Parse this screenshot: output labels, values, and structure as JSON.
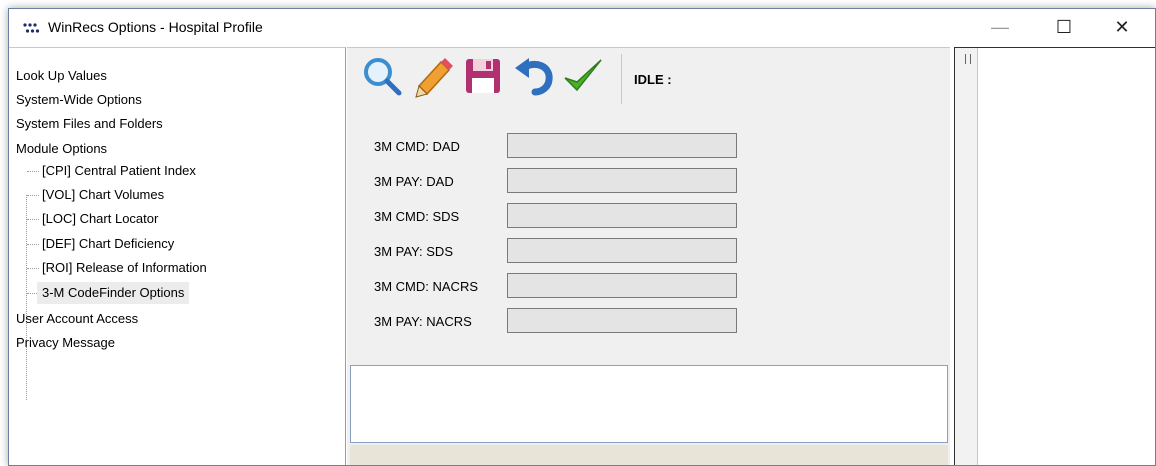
{
  "window": {
    "title": "WinRecs Options - Hospital Profile",
    "controls": {
      "minimize": "—",
      "maximize": "☐",
      "close": "✕"
    }
  },
  "tree": {
    "items": [
      {
        "label": "Look Up Values",
        "level": 0
      },
      {
        "label": "System-Wide Options",
        "level": 0
      },
      {
        "label": "System Files and Folders",
        "level": 0
      },
      {
        "label": "Module Options",
        "level": 0
      },
      {
        "label": "[CPI] Central Patient Index",
        "level": 1
      },
      {
        "label": "[VOL] Chart Volumes",
        "level": 1
      },
      {
        "label": "[LOC] Chart Locator",
        "level": 1
      },
      {
        "label": "[DEF] Chart Deficiency",
        "level": 1
      },
      {
        "label": "[ROI] Release of Information",
        "level": 1
      },
      {
        "label": "3-M CodeFinder Options",
        "level": 1,
        "selected": true
      },
      {
        "label": "User Account Access",
        "level": 0
      },
      {
        "label": "Privacy Message",
        "level": 0
      }
    ]
  },
  "toolbar": {
    "buttons": [
      {
        "icon": "magnifier-icon",
        "name": "search"
      },
      {
        "icon": "pencil-icon",
        "name": "edit"
      },
      {
        "icon": "floppy-disk-icon",
        "name": "save"
      },
      {
        "icon": "undo-arrow-icon",
        "name": "undo"
      },
      {
        "icon": "checkmark-icon",
        "name": "accept"
      }
    ],
    "status": "IDLE :"
  },
  "fields": [
    {
      "label": "3M CMD: DAD",
      "value": ""
    },
    {
      "label": "3M PAY: DAD",
      "value": ""
    },
    {
      "label": "3M CMD: SDS",
      "value": ""
    },
    {
      "label": "3M PAY: SDS",
      "value": ""
    },
    {
      "label": "3M CMD: NACRS",
      "value": ""
    },
    {
      "label": "3M PAY: NACRS",
      "value": ""
    }
  ],
  "colors": {
    "accent_blue": "#2f6fbf",
    "pencil_orange": "#f0a030",
    "save_purple": "#b03070",
    "check_green": "#4caf28"
  }
}
